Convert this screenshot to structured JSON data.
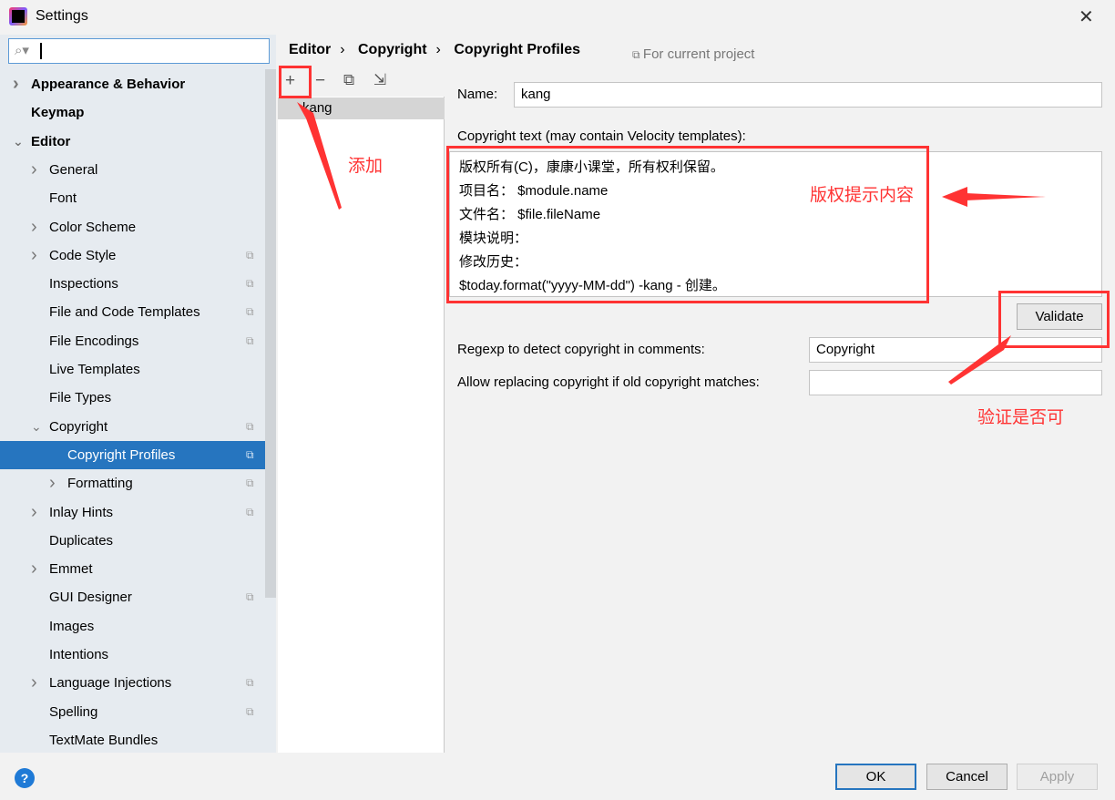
{
  "window": {
    "title": "Settings",
    "close": "✕"
  },
  "search": {
    "value": ""
  },
  "sidebar": {
    "items": [
      {
        "label": "Appearance & Behavior",
        "level": 0,
        "chevron": "right",
        "bold": true
      },
      {
        "label": "Keymap",
        "level": 0,
        "bold": true
      },
      {
        "label": "Editor",
        "level": 0,
        "chevron": "down",
        "bold": true
      },
      {
        "label": "General",
        "level": 1,
        "chevron": "right"
      },
      {
        "label": "Font",
        "level": 1
      },
      {
        "label": "Color Scheme",
        "level": 1,
        "chevron": "right"
      },
      {
        "label": "Code Style",
        "level": 1,
        "chevron": "right",
        "project": true
      },
      {
        "label": "Inspections",
        "level": 1,
        "project": true
      },
      {
        "label": "File and Code Templates",
        "level": 1,
        "project": true
      },
      {
        "label": "File Encodings",
        "level": 1,
        "project": true
      },
      {
        "label": "Live Templates",
        "level": 1
      },
      {
        "label": "File Types",
        "level": 1
      },
      {
        "label": "Copyright",
        "level": 1,
        "chevron": "down",
        "project": true
      },
      {
        "label": "Copyright Profiles",
        "level": 2,
        "project": true,
        "selected": true
      },
      {
        "label": "Formatting",
        "level": 2,
        "chevron": "right",
        "project": true
      },
      {
        "label": "Inlay Hints",
        "level": 1,
        "chevron": "right",
        "project": true
      },
      {
        "label": "Duplicates",
        "level": 1
      },
      {
        "label": "Emmet",
        "level": 1,
        "chevron": "right"
      },
      {
        "label": "GUI Designer",
        "level": 1,
        "project": true
      },
      {
        "label": "Images",
        "level": 1
      },
      {
        "label": "Intentions",
        "level": 1
      },
      {
        "label": "Language Injections",
        "level": 1,
        "chevron": "right",
        "project": true
      },
      {
        "label": "Spelling",
        "level": 1,
        "project": true
      },
      {
        "label": "TextMate Bundles",
        "level": 1
      }
    ]
  },
  "breadcrumb": [
    "Editor",
    "Copyright",
    "Copyright Profiles"
  ],
  "for_current_project": "For current project",
  "toolbar": {
    "add": "+",
    "remove": "−",
    "copy": "⧉",
    "import": "⇲"
  },
  "profiles": [
    "kang"
  ],
  "form": {
    "name_label": "Name:",
    "name_value": "kang",
    "copyright_label": "Copyright text (may contain Velocity templates):",
    "copyright_lines": [
      "版权所有(C)，康康小课堂，所有权利保留。",
      "项目名：  $module.name",
      "文件名：  $file.fileName",
      "模块说明：",
      "修改历史：",
      "$today.format(\"yyyy-MM-dd\") -kang - 创建。"
    ],
    "validate": "Validate",
    "regexp_label": "Regexp to detect copyright in comments:",
    "regexp_value": "Copyright",
    "allow_label": "Allow replacing copyright if old copyright matches:",
    "allow_value": ""
  },
  "buttons": {
    "ok": "OK",
    "cancel": "Cancel",
    "apply": "Apply",
    "help": "?"
  },
  "annotations": {
    "add": "添加",
    "content": "版权提示内容",
    "validate": "验证是否可"
  },
  "colors": {
    "selection": "#2675bf",
    "annotation": "#ff3333"
  }
}
